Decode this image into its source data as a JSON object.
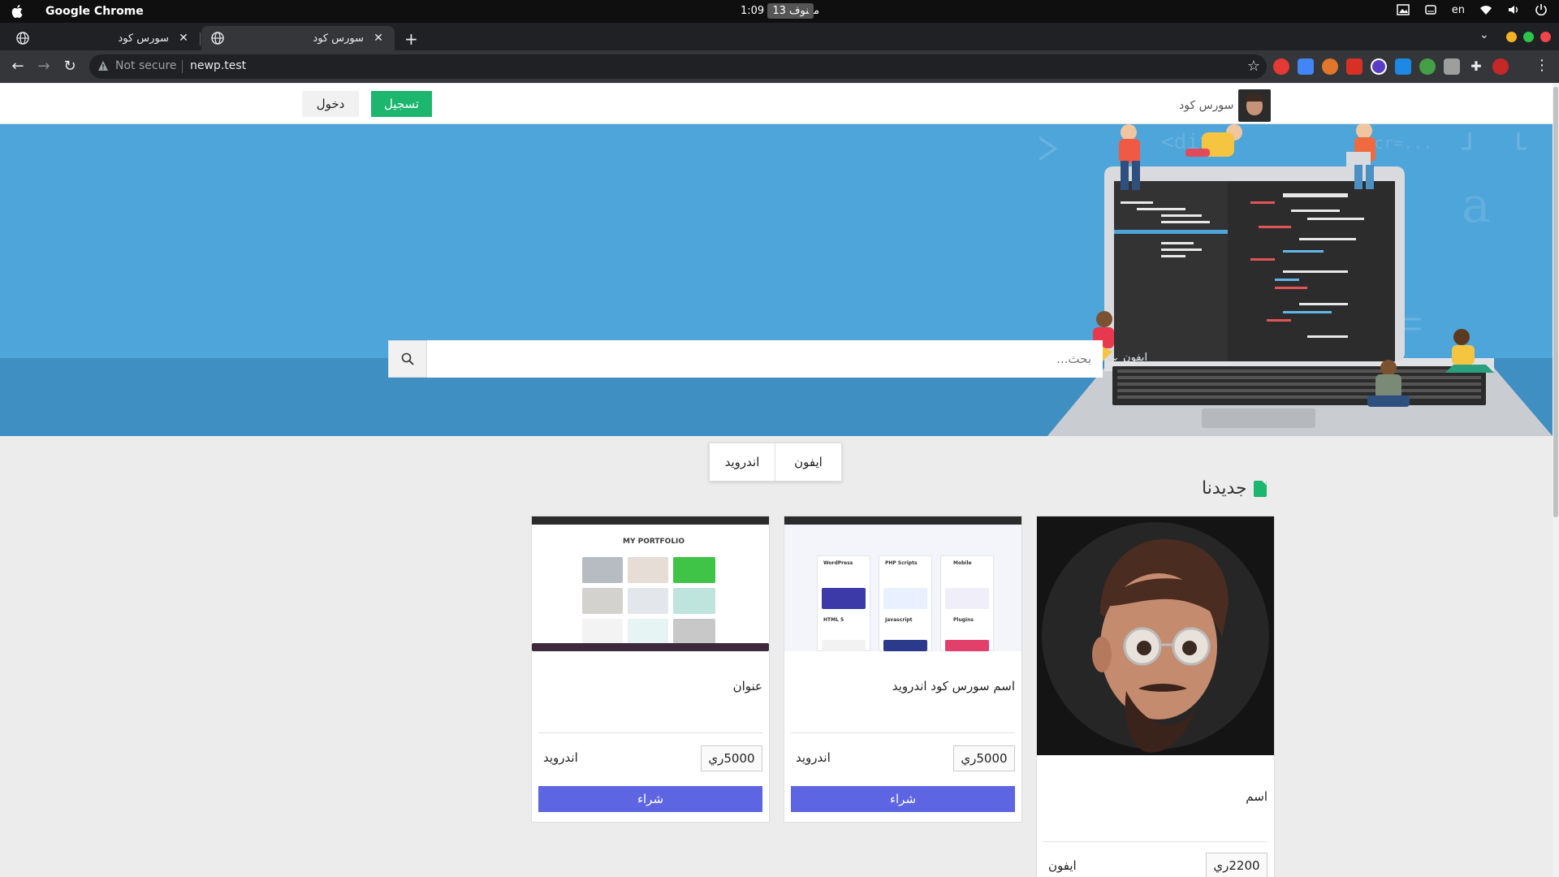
{
  "os": {
    "app_name": "Google Chrome",
    "time": "1:09 م",
    "date": "نوف 13",
    "lang": "en"
  },
  "browser": {
    "tabs": [
      {
        "title": "سورس كود",
        "active": false
      },
      {
        "title": "سورس كود",
        "active": true
      }
    ],
    "security_label": "Not secure",
    "url": "newp.test"
  },
  "site": {
    "brand": "سورس كود",
    "register_label": "تسجيل",
    "login_label": "دخول"
  },
  "hero": {
    "search_placeholder": "بحث...",
    "search_category": "ايفون"
  },
  "filters": [
    {
      "label": "ايفون"
    },
    {
      "label": "اندرويد"
    }
  ],
  "section": {
    "title": "جديدنا"
  },
  "cards": [
    {
      "title": "اسم",
      "price": "2200ري",
      "category": "ايفون",
      "buy_label": ""
    },
    {
      "title": "اسم سورس كود اندرويد",
      "price": "5000ري",
      "category": "اندرويد",
      "buy_label": "شراء"
    },
    {
      "title": "عنوان",
      "price": "5000ري",
      "category": "اندرويد",
      "buy_label": "شراء"
    }
  ],
  "thumb_texts": {
    "portfolio": "MY PORTFOLIO",
    "wordpress": "WordPress",
    "php": "PHP Scripts",
    "mobile": "Mobile",
    "html": "HTML 5",
    "javascript": "Javascript",
    "plugins": "Plugins"
  },
  "colors": {
    "accent_green": "#1cb66f",
    "buy_button": "#5d65e3",
    "hero_blue": "#4ea5d9"
  }
}
